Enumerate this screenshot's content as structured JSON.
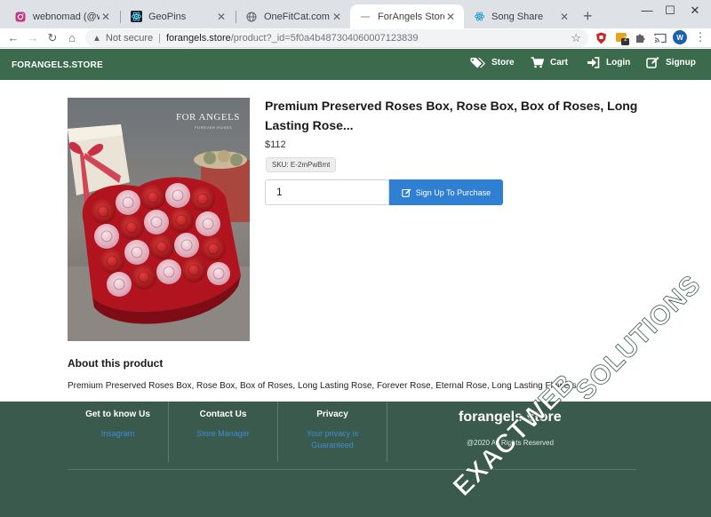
{
  "browser": {
    "tabs": [
      {
        "title": "webnomad (@webnomad)",
        "active": false
      },
      {
        "title": "GeoPins",
        "active": false
      },
      {
        "title": "OneFitCat.com Solutions",
        "active": false
      },
      {
        "title": "ForAngels Store",
        "active": true
      },
      {
        "title": "Song Share",
        "active": false
      }
    ],
    "address": {
      "security_label": "Not secure",
      "host": "forangels.store",
      "path": "/product?_id=5f0a4b487304060007123839"
    },
    "profile_initial": "W",
    "extension_badge": "2"
  },
  "header": {
    "brand": "FORANGELS.STORE",
    "nav": [
      {
        "label": "Store",
        "icon": "tags-icon"
      },
      {
        "label": "Cart",
        "icon": "cart-icon"
      },
      {
        "label": "Login",
        "icon": "login-icon"
      },
      {
        "label": "Signup",
        "icon": "signup-icon"
      }
    ]
  },
  "product": {
    "image_brand": "FOR ANGELS",
    "image_sub": "FOREVER ROSES",
    "title": "Premium Preserved Roses Box, Rose Box, Box of Roses, Long Lasting Rose...",
    "price": "$112",
    "sku": "SKU: E-2mPwBmt",
    "quantity": "1",
    "purchase_button": "Sign Up To Purchase",
    "about_heading": "About this product",
    "about_text": "Premium Preserved Roses Box, Rose Box, Box of Roses, Long Lasting Rose, Forever Rose, Eternal Rose, Long Lasting Flowers"
  },
  "footer": {
    "columns": [
      {
        "heading": "Get to know Us",
        "links": [
          "Insagram"
        ]
      },
      {
        "heading": "Contact Us",
        "links": [
          "Store Manager"
        ]
      },
      {
        "heading": "Privacy",
        "links": [
          "Your privacy is Guaranteed"
        ]
      }
    ],
    "brand": "forangels.store",
    "copyright": "@2020 All Rights Reserved"
  },
  "watermark": {
    "line1": "EXACTWEB",
    "line2": "SOLUTIONS"
  },
  "colors": {
    "header_green": "#3c6a4d",
    "footer_green": "#3a5a4d",
    "button_blue": "#2f80d1",
    "link_blue": "#3d8ed6"
  }
}
